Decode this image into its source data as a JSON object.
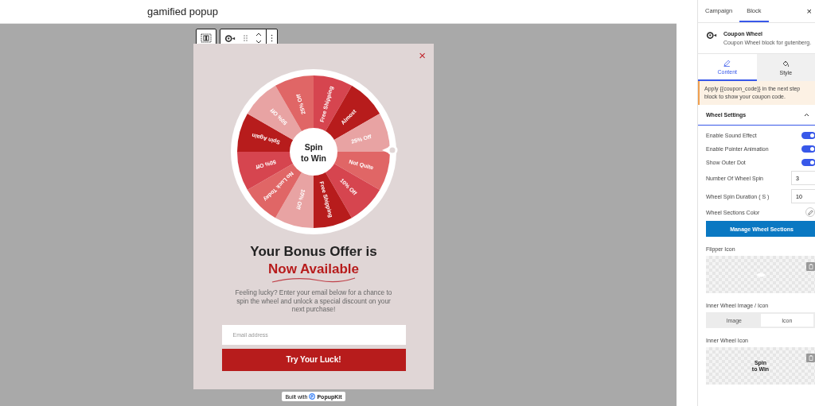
{
  "editor": {
    "title": "gamified popup"
  },
  "popup": {
    "close": "×",
    "wheel": {
      "center": [
        "Spin",
        "to Win"
      ],
      "segments": [
        {
          "label": "Free Shipping",
          "color": "#d6454f"
        },
        {
          "label": "Almost",
          "color": "#b71c1c"
        },
        {
          "label": "25% Off",
          "color": "#e8a3a3"
        },
        {
          "label": "Not Quite",
          "color": "#e06666"
        },
        {
          "label": "10% Off",
          "color": "#d6454f"
        },
        {
          "label": "Free Shipping",
          "color": "#b71c1c"
        },
        {
          "label": "10% Off",
          "color": "#e8a3a3"
        },
        {
          "label": "No Luck Today",
          "color": "#e06666"
        },
        {
          "label": "50% Off",
          "color": "#d6454f"
        },
        {
          "label": "Spin Again",
          "color": "#b71c1c"
        },
        {
          "label": "50% Off",
          "color": "#e8a3a3"
        },
        {
          "label": "25% Off",
          "color": "#e06666"
        }
      ]
    },
    "heading": "Your Bonus Offer is",
    "highlight": "Now Available",
    "description": "Feeling lucky? Enter your email below for a chance to spin the wheel and unlock a special discount on your next purchase!",
    "email": {
      "placeholder": "Email address"
    },
    "button": "Try Your Luck!"
  },
  "badge": {
    "prefix": "Built with",
    "brand": "PopupKit"
  },
  "sidebar": {
    "tabs": [
      {
        "label": "Campaign",
        "selected": false
      },
      {
        "label": "Block",
        "selected": true
      }
    ],
    "close": "×",
    "block": {
      "name": "Coupon Wheel",
      "description": "Coupon Wheel block for gutenberg."
    },
    "panel_tabs": [
      {
        "label": "Content",
        "selected": true
      },
      {
        "label": "Style",
        "selected": false
      }
    ],
    "notice": "Apply {{coupon_code}} in the next step block to show your coupon code.",
    "section": {
      "title": "Wheel Settings",
      "expanded": true
    },
    "settings": [
      {
        "kind": "toggle",
        "label": "Enable Sound Effect",
        "on": true
      },
      {
        "kind": "toggle",
        "label": "Enable Pointer Animation",
        "on": true
      },
      {
        "kind": "toggle",
        "label": "Show Outer Dot",
        "on": true
      },
      {
        "kind": "number",
        "label": "Number Of Wheel Spin",
        "value": "3"
      },
      {
        "kind": "number",
        "label": "Wheel Spin Duration ( S )",
        "value": "10"
      },
      {
        "kind": "color",
        "label": "Wheel Sections Color"
      }
    ],
    "manage_button": "Manage Wheel Sections",
    "flipper": {
      "label": "Flipper Icon"
    },
    "inner_mode": {
      "label": "Inner Wheel Image / Icon",
      "options": [
        {
          "label": "Image",
          "selected": false
        },
        {
          "label": "Icon",
          "selected": true
        }
      ]
    },
    "inner_icon": {
      "label": "Inner Wheel Icon",
      "preview": [
        "Spin",
        "to Win"
      ]
    }
  }
}
